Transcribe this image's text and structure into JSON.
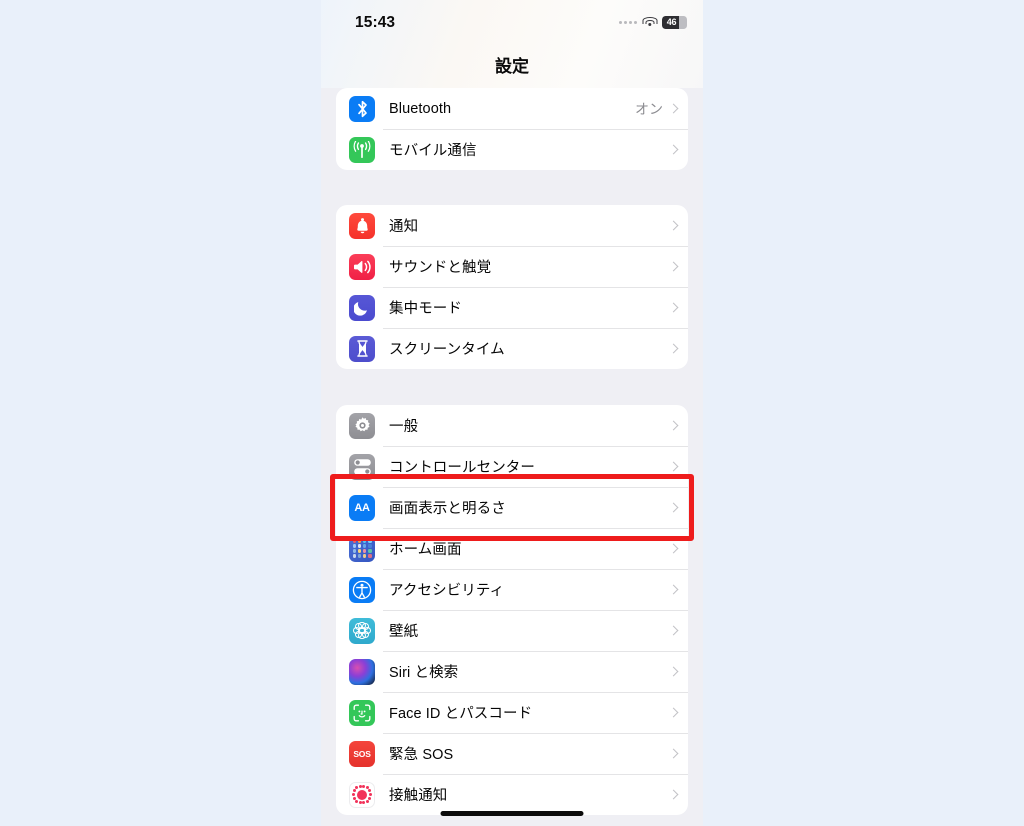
{
  "status_bar": {
    "time": "15:43",
    "battery_percent": "46",
    "wifi_icon": "wifi-icon",
    "signal_icon": "signal-dots-icon",
    "battery_icon": "battery-icon"
  },
  "nav": {
    "title": "設定"
  },
  "groups": [
    {
      "id": "connectivity",
      "rows": [
        {
          "label": "Bluetooth",
          "value": "オン",
          "icon": "bluetooth-icon",
          "icon_class": "i-bt",
          "art": "bluetooth"
        },
        {
          "label": "モバイル通信",
          "value": "",
          "icon": "cellular-icon",
          "icon_class": "i-cell",
          "art": "cellular"
        }
      ]
    },
    {
      "id": "alerts",
      "rows": [
        {
          "label": "通知",
          "value": "",
          "icon": "notifications-bell-icon",
          "icon_class": "i-notif",
          "art": "bell"
        },
        {
          "label": "サウンドと触覚",
          "value": "",
          "icon": "sounds-speaker-icon",
          "icon_class": "i-sound",
          "art": "speaker"
        },
        {
          "label": "集中モード",
          "value": "",
          "icon": "focus-moon-icon",
          "icon_class": "i-focus",
          "art": "moon"
        },
        {
          "label": "スクリーンタイム",
          "value": "",
          "icon": "screen-time-hourglass-icon",
          "icon_class": "i-screen",
          "art": "hourglass"
        }
      ]
    },
    {
      "id": "system",
      "rows": [
        {
          "label": "一般",
          "value": "",
          "icon": "general-gear-icon",
          "icon_class": "i-gen",
          "art": "gear"
        },
        {
          "label": "コントロールセンター",
          "value": "",
          "icon": "control-center-toggles-icon",
          "icon_class": "i-cc",
          "art": "toggles"
        },
        {
          "label": "画面表示と明るさ",
          "value": "",
          "icon": "display-brightness-aa-icon",
          "icon_class": "i-disp",
          "art": "aa"
        },
        {
          "label": "ホーム画面",
          "value": "",
          "icon": "home-screen-grid-icon",
          "icon_class": "i-home",
          "art": "grid"
        },
        {
          "label": "アクセシビリティ",
          "value": "",
          "icon": "accessibility-icon",
          "icon_class": "i-acc",
          "art": "accessibility"
        },
        {
          "label": "壁紙",
          "value": "",
          "icon": "wallpaper-flower-icon",
          "icon_class": "i-wall",
          "art": "flower"
        },
        {
          "label": "Siri と検索",
          "value": "",
          "icon": "siri-orb-icon",
          "icon_class": "i-siri",
          "art": "siri"
        },
        {
          "label": "Face ID とパスコード",
          "value": "",
          "icon": "face-id-icon",
          "icon_class": "i-face",
          "art": "faceid"
        },
        {
          "label": "緊急 SOS",
          "value": "",
          "icon": "emergency-sos-icon",
          "icon_class": "i-sos",
          "art": "sos"
        },
        {
          "label": "接触通知",
          "value": "",
          "icon": "exposure-notifications-icon",
          "icon_class": "i-expo",
          "art": "exposure"
        }
      ]
    }
  ],
  "highlight": {
    "target_label": "画面表示と明るさ",
    "color": "#ee1c1c"
  },
  "colors": {
    "page_background": "#e9f0fa",
    "screen_background": "#efeff4",
    "card": "#ffffff",
    "separator": "#e4e4e6",
    "secondary_text": "#8b8b90",
    "chevron": "#c2c2c6"
  }
}
